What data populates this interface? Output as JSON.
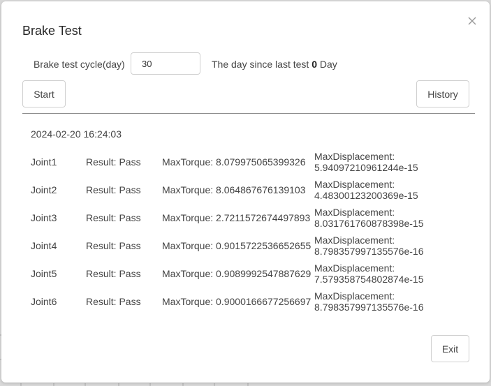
{
  "dialog": {
    "title": "Brake Test",
    "cycle_label": "Brake test cycle(day)",
    "cycle_value": "30",
    "since_prefix": "The day since last test",
    "since_days": "0",
    "since_suffix": "Day",
    "start_label": "Start",
    "history_label": "History",
    "exit_label": "Exit",
    "timestamp": "2024-02-20 16:24:03"
  },
  "results": [
    {
      "joint": "Joint1",
      "result": "Result: Pass",
      "torque": "MaxTorque: 8.079975065399326",
      "disp_label": "MaxDisplacement:",
      "disp_value": "5.94097210961244e-15"
    },
    {
      "joint": "Joint2",
      "result": "Result: Pass",
      "torque": "MaxTorque: 8.064867676139103",
      "disp_label": "MaxDisplacement:",
      "disp_value": "4.48300123200369e-15"
    },
    {
      "joint": "Joint3",
      "result": "Result: Pass",
      "torque": "MaxTorque: 2.7211572674497893",
      "disp_label": "MaxDisplacement:",
      "disp_value": "8.031761760878398e-15"
    },
    {
      "joint": "Joint4",
      "result": "Result: Pass",
      "torque": "MaxTorque: 0.9015722536652655",
      "disp_label": "MaxDisplacement:",
      "disp_value": "8.798357997135576e-16"
    },
    {
      "joint": "Joint5",
      "result": "Result: Pass",
      "torque": "MaxTorque: 0.9089992547887629",
      "disp_label": "MaxDisplacement:",
      "disp_value": "7.579358754802874e-15"
    },
    {
      "joint": "Joint6",
      "result": "Result: Pass",
      "torque": "MaxTorque: 0.9000166677256697",
      "disp_label": "MaxDisplacement:",
      "disp_value": "8.798357997135576e-16"
    }
  ]
}
